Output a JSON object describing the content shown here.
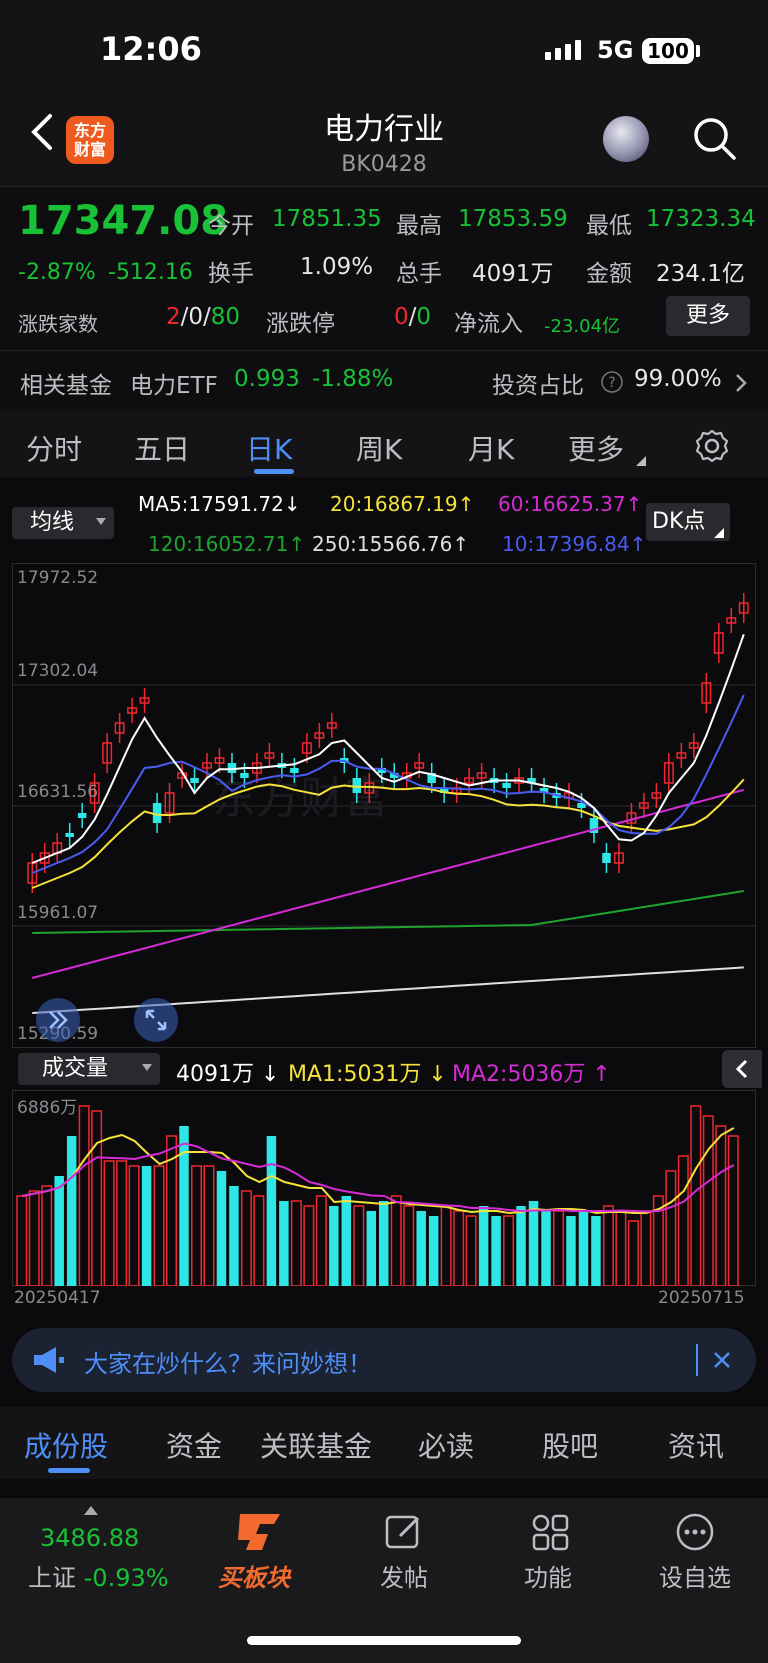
{
  "status": {
    "time": "12:06",
    "network": "5G",
    "battery": "100"
  },
  "header": {
    "title": "电力行业",
    "code": "BK0428",
    "logo": "东方\n财富"
  },
  "quote": {
    "price": "17347.08",
    "change_pct": "-2.87%",
    "change": "-512.16",
    "open_label": "今开",
    "open": "17851.35",
    "high_label": "最高",
    "high": "17853.59",
    "low_label": "最低",
    "low": "17323.34",
    "turnover_label": "换手",
    "turnover": "1.09%",
    "volume_label": "总手",
    "volume": "4091万",
    "amount_label": "金额",
    "amount": "234.1亿",
    "breadth_label": "涨跌家数",
    "breadth_up": "2",
    "breadth_sep1": "/",
    "breadth_flat": "0",
    "breadth_sep2": "/",
    "breadth_down": "80",
    "limit_label": "涨跌停",
    "limit_up": "0",
    "limit_sep": "/",
    "limit_down": "0",
    "inflow_label": "净流入",
    "inflow": "-23.04亿",
    "more": "更多"
  },
  "fund": {
    "label": "相关基金",
    "name": "电力ETF",
    "price": "0.993",
    "change": "-1.88%",
    "ratio_label": "投资占比",
    "ratio": "99.00%"
  },
  "tabs": [
    "分时",
    "五日",
    "日K",
    "周K",
    "月K",
    "更多"
  ],
  "ma": {
    "selector": "均线",
    "ma5": "MA5:17591.72",
    "ma20": "20:16867.19",
    "ma60": "60:16625.37",
    "ma120": "120:16052.71",
    "ma250": "250:15566.76",
    "ma10": "10:17396.84",
    "dk": "DK点"
  },
  "axis": {
    "y1": "17972.52",
    "y2": "17302.04",
    "y3": "16631.56",
    "y4": "15961.07",
    "y5": "15290.59"
  },
  "volume": {
    "selector": "成交量",
    "value": "4091万",
    "ma1": "MA1:5031万",
    "ma2": "MA2:5036万",
    "max": "6886万",
    "date_start": "20250417",
    "date_end": "20250715"
  },
  "colors": {
    "up": "#f0272f",
    "down": "#2ee6e6",
    "ma5": "#ffffff",
    "ma10": "#4a5bf0",
    "ma20": "#f5e23a",
    "ma60": "#d62bd6",
    "ma120": "#1fa52e",
    "ma250": "#e0e0e0"
  },
  "ask": {
    "text": "大家在炒什么？来问妙想！"
  },
  "bottom_tabs": [
    "成份股",
    "资金",
    "关联基金",
    "必读",
    "股吧",
    "资讯"
  ],
  "footer": {
    "index_value": "3486.88",
    "index_name": "上证",
    "index_change": "-0.93%",
    "buy": "买板块",
    "post": "发帖",
    "func": "功能",
    "watch": "设自选"
  }
}
